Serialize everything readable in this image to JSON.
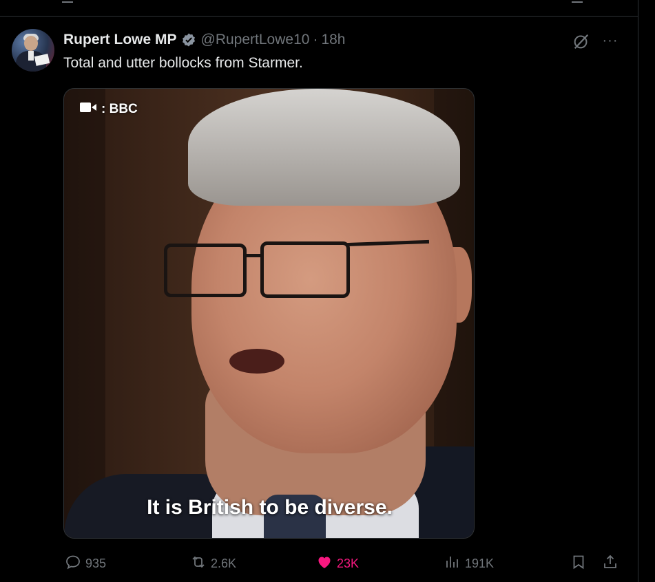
{
  "tweet": {
    "author_name": "Rupert Lowe MP",
    "handle": "@RupertLowe10",
    "separator": "·",
    "time": "18h",
    "text": "Total and utter bollocks from Starmer.",
    "more_label": "···"
  },
  "media": {
    "source_badge": ": BBC",
    "caption": "It is British to be diverse."
  },
  "actions": {
    "replies": "935",
    "reposts": "2.6K",
    "likes": "23K",
    "views": "191K"
  },
  "colors": {
    "background": "#000000",
    "text": "#e7e9ea",
    "muted": "#71767b",
    "verified": "#1d9bf0",
    "like": "#f91880",
    "border": "#2f3336"
  },
  "icons": {
    "verified": "verified-badge-icon",
    "grok": "grok-icon",
    "more": "more-icon",
    "video_camera": "video-camera-icon",
    "reply": "reply-icon",
    "repost": "repost-icon",
    "like": "heart-icon",
    "views": "views-icon",
    "bookmark": "bookmark-icon",
    "share": "share-icon"
  }
}
